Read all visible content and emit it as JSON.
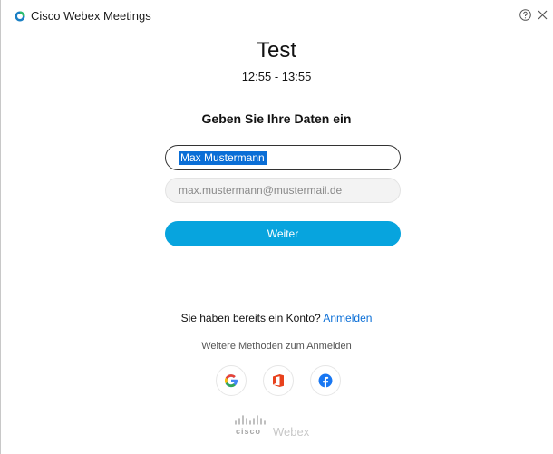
{
  "window": {
    "title": "Cisco Webex Meetings",
    "icons": [
      "webex-logo-icon",
      "help-icon",
      "close-icon"
    ]
  },
  "meeting": {
    "title": "Test",
    "time": "12:55 - 13:55"
  },
  "form": {
    "heading": "Geben Sie Ihre Daten ein",
    "name_value": "Max Mustermann",
    "email_placeholder": "max.mustermann@mustermail.de",
    "submit_label": "Weiter"
  },
  "account": {
    "prompt": "Sie haben bereits ein Konto?",
    "signin_link": "Anmelden"
  },
  "alternative": {
    "label": "Weitere Methoden zum Anmelden",
    "providers": [
      "google-icon",
      "office-icon",
      "facebook-icon"
    ]
  },
  "footer": {
    "brand_cisco": "cisco",
    "brand_webex": "Webex"
  },
  "colors": {
    "accent": "#07a4de",
    "link": "#0a6ed6",
    "selection": "#0a6ed6"
  }
}
